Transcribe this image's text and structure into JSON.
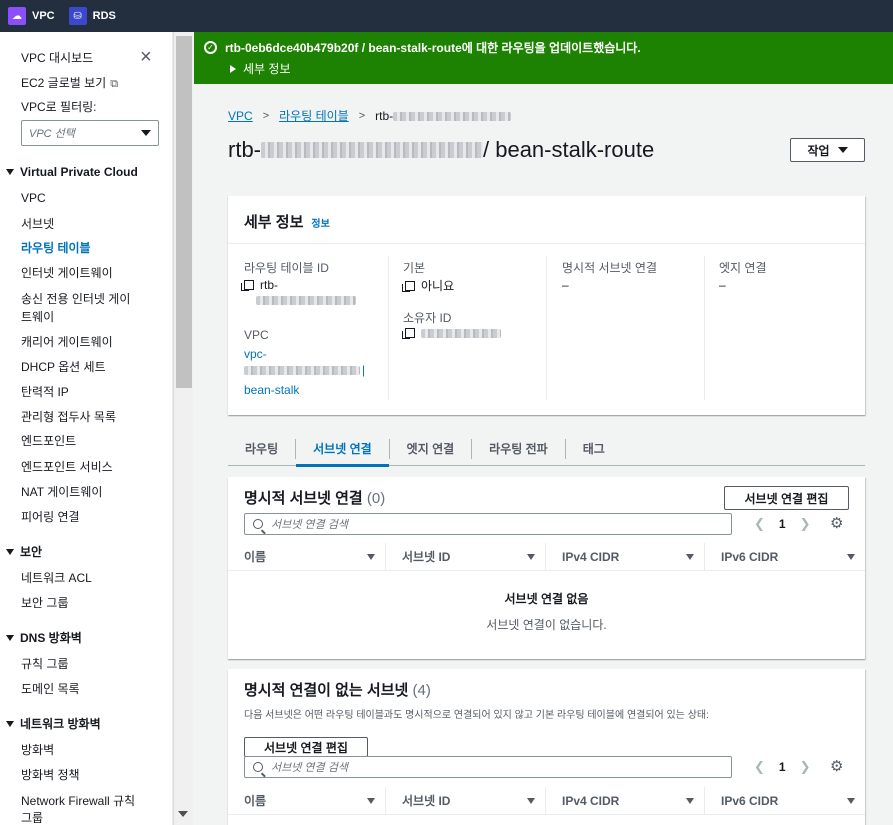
{
  "topbar": {
    "services": [
      {
        "label": "VPC"
      },
      {
        "label": "RDS"
      }
    ]
  },
  "sidebar": {
    "dashboard": "VPC 대시보드",
    "ec2_global": "EC2 글로벌 보기",
    "filter_label": "VPC로 필터링:",
    "vpc_select_placeholder": "VPC 선택",
    "section_vpc": "Virtual Private Cloud",
    "vpc_items": [
      "VPC",
      "서브넷",
      "라우팅 테이블",
      "인터넷 게이트웨이",
      "송신 전용 인터넷 게이",
      "트웨이",
      "캐리어 게이트웨이",
      "DHCP 옵션 세트",
      "탄력적 IP",
      "관리형 접두사 목록",
      "엔드포인트",
      "엔드포인트 서비스",
      "NAT 게이트웨이",
      "피어링 연결"
    ],
    "section_security": "보안",
    "security_items": [
      "네트워크 ACL",
      "보안 그룹"
    ],
    "section_dns": "DNS 방화벽",
    "dns_items": [
      "규칙 그룹",
      "도메인 목록"
    ],
    "section_nfw": "네트워크 방화벽",
    "nfw_items": [
      "방화벽",
      "방화벽 정책",
      "Network Firewall 규칙",
      "그룹"
    ]
  },
  "banner": {
    "message": "rtb-0eb6dce40b479b20f / bean-stalk-route에 대한 라우팅을 업데이트했습니다.",
    "detail": "세부 정보",
    "color": "#1d8102"
  },
  "breadcrumb": {
    "vpc": "VPC",
    "route_tables": "라우팅 테이블",
    "current": "rtb-"
  },
  "title": {
    "prefix": "rtb-",
    "suffix": " / bean-stalk-route"
  },
  "actions_label": "작업",
  "details": {
    "heading": "세부 정보",
    "info": "정보",
    "route_table_id_label": "라우팅 테이블 ID",
    "route_table_id_value": "rtb-",
    "vpc_label": "VPC",
    "vpc_value": "vpc-",
    "vpc_name": "bean-stalk",
    "main_label": "기본",
    "main_value": "아니요",
    "owner_label": "소유자 ID",
    "explicit_label": "명시적 서브넷 연결",
    "explicit_value": "–",
    "edge_label": "엣지 연결",
    "edge_value": "–"
  },
  "tabs": [
    "라우팅",
    "서브넷 연결",
    "엣지 연결",
    "라우팅 전파",
    "태그"
  ],
  "explicit": {
    "title": "명시적 서브넷 연결",
    "count": "(0)",
    "edit_button": "서브넷 연결 편집",
    "search_placeholder": "서브넷 연결 검색",
    "page": "1",
    "columns": [
      "이름",
      "서브넷 ID",
      "IPv4 CIDR",
      "IPv6 CIDR"
    ],
    "empty_title": "서브넷 연결 없음",
    "empty_sub": "서브넷 연결이 없습니다."
  },
  "nonexplicit": {
    "title": "명시적 연결이 없는 서브넷",
    "count": "(4)",
    "description": "다음 서브넷은 어떤 라우팅 테이블과도 명시적으로 연결되어 있지 않고 기본 라우팅 테이블에 연결되어 있는 상태:",
    "edit_button": "서브넷 연결 편집",
    "search_placeholder": "서브넷 연결 검색",
    "page": "1",
    "columns": [
      "이름",
      "서브넷 ID",
      "IPv4 CIDR",
      "IPv6 CIDR"
    ]
  }
}
